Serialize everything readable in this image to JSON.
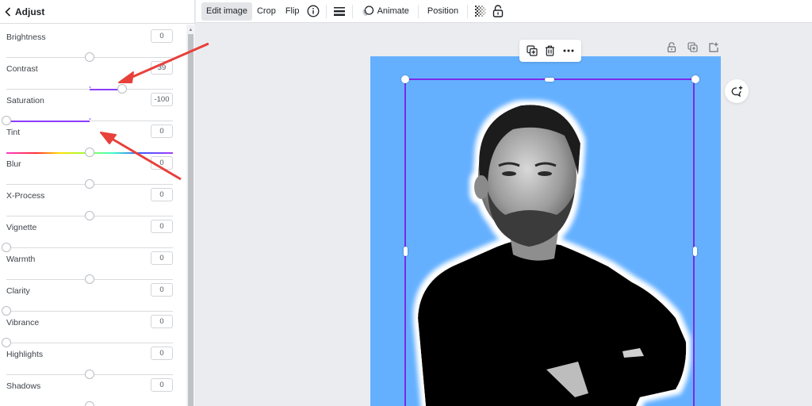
{
  "panel": {
    "title": "Adjust",
    "controls": [
      {
        "label": "Brightness",
        "value": "0",
        "position": 0.5,
        "fill": null
      },
      {
        "label": "Contrast",
        "value": "39",
        "position": 0.695,
        "fill": "positive"
      },
      {
        "label": "Saturation",
        "value": "-100",
        "position": 0.0,
        "fill": "negative"
      },
      {
        "label": "Tint",
        "value": "0",
        "position": 0.5,
        "fill": "rainbow"
      },
      {
        "label": "Blur",
        "value": "0",
        "position": 0.5,
        "fill": null
      },
      {
        "label": "X-Process",
        "value": "0",
        "position": 0.5,
        "fill": null
      },
      {
        "label": "Vignette",
        "value": "0",
        "position": 0.0,
        "fill": null
      },
      {
        "label": "Warmth",
        "value": "0",
        "position": 0.5,
        "fill": null
      },
      {
        "label": "Clarity",
        "value": "0",
        "position": 0.0,
        "fill": null
      },
      {
        "label": "Vibrance",
        "value": "0",
        "position": 0.0,
        "fill": null
      },
      {
        "label": "Highlights",
        "value": "0",
        "position": 0.5,
        "fill": null
      },
      {
        "label": "Shadows",
        "value": "0",
        "position": 0.5,
        "fill": null
      }
    ]
  },
  "toolbar": {
    "edit_image": "Edit image",
    "crop": "Crop",
    "flip": "Flip",
    "animate": "Animate",
    "position": "Position"
  },
  "icons": {
    "back": "chevron-left-icon",
    "info": "info-icon",
    "border_style": "border-style-icon",
    "animate": "animate-icon",
    "transparency": "transparency-icon",
    "lock": "lock-icon"
  },
  "colors": {
    "accent": "#8b3dff",
    "selection": "#7d2ae8",
    "design_background": "#64b0ff",
    "annotation_arrow": "#e8403a"
  }
}
